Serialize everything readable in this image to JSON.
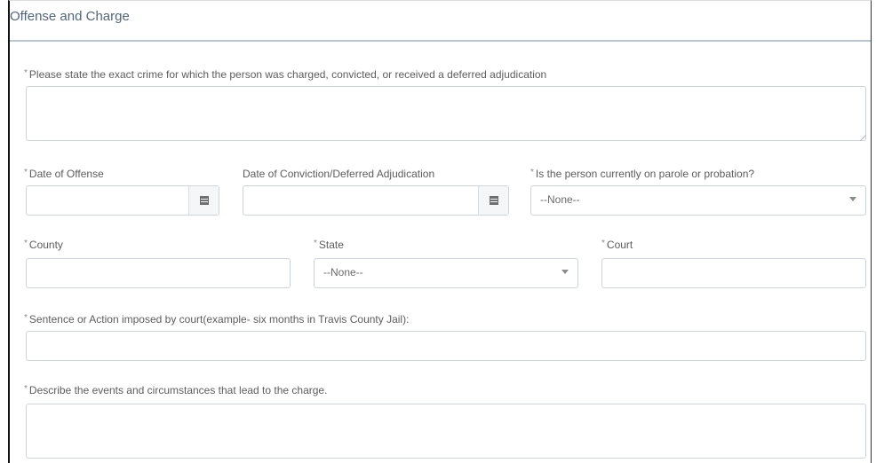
{
  "section": {
    "title": "Offense and Charge"
  },
  "fields": {
    "crime": {
      "label": "Please state the exact crime for which the person was charged, convicted, or received a deferred adjudication",
      "value": ""
    },
    "date_offense": {
      "label": "Date of Offense",
      "value": "",
      "icon": "calendar-icon"
    },
    "date_conviction": {
      "label": "Date of Conviction/Deferred Adjudication",
      "value": "",
      "icon": "calendar-icon"
    },
    "parole": {
      "label": "Is the person currently on parole or probation?",
      "selected": "--None--"
    },
    "county": {
      "label": "County",
      "value": ""
    },
    "state": {
      "label": "State",
      "selected": "--None--"
    },
    "court": {
      "label": "Court",
      "value": ""
    },
    "sentence": {
      "label": "Sentence or Action imposed by court(example- six months in Travis County Jail):",
      "value": ""
    },
    "describe": {
      "label": "Describe the events and circumstances that lead to the charge.",
      "value": ""
    }
  },
  "required_marker": "*"
}
